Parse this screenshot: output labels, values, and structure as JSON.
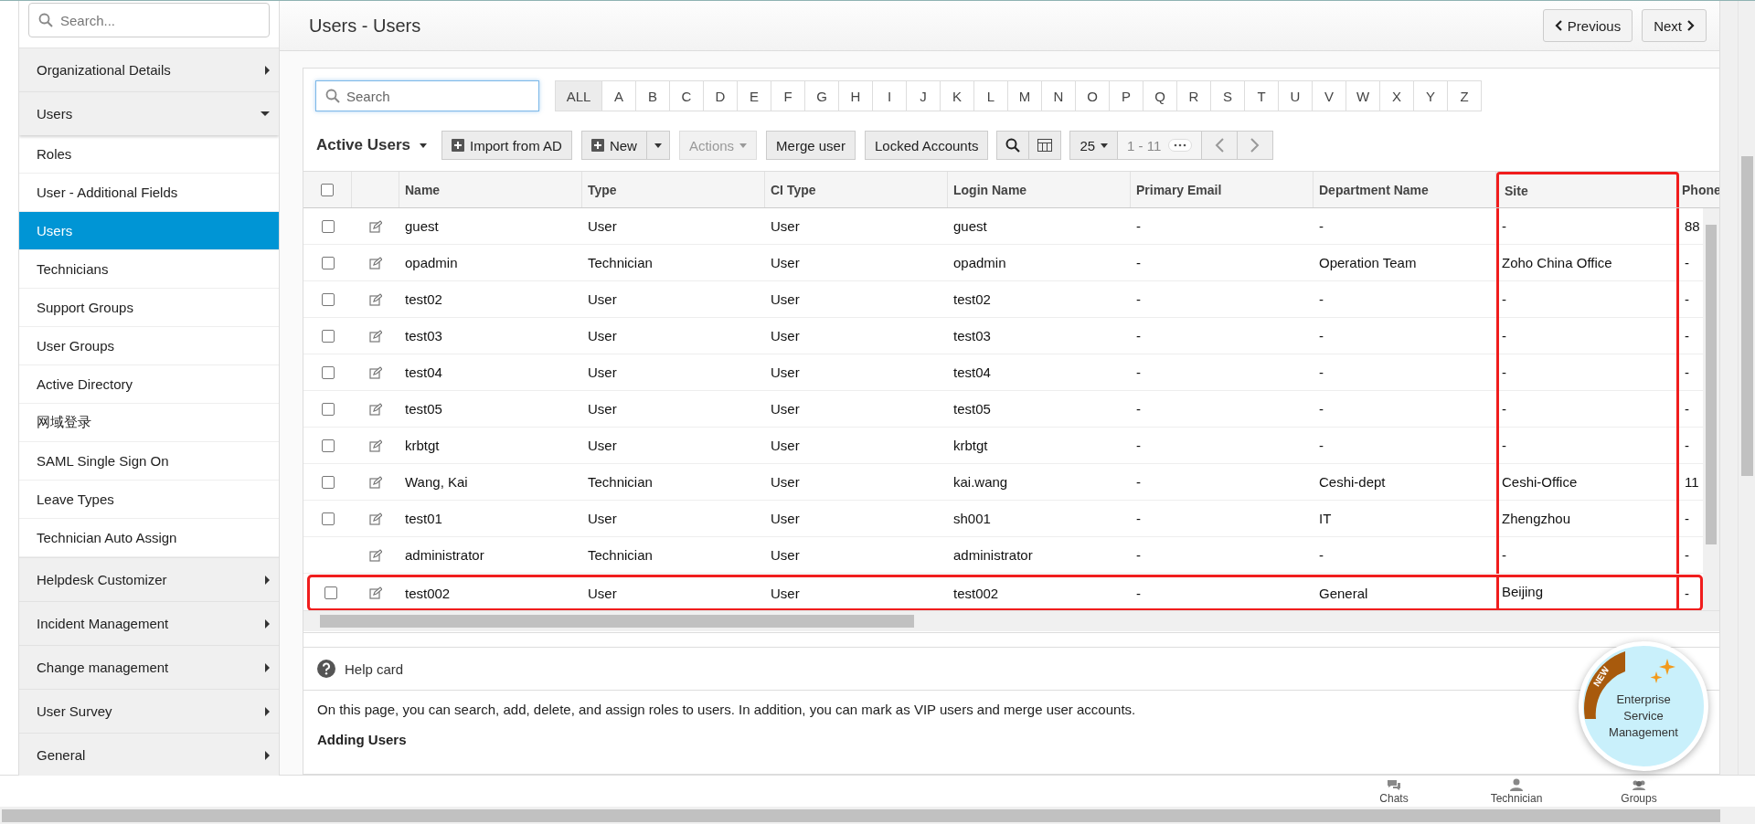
{
  "sidebar": {
    "search": {
      "placeholder": "Search..."
    },
    "sections": [
      {
        "label": "Organizational Details",
        "expanded": false
      },
      {
        "label": "Users",
        "expanded": true,
        "children": [
          {
            "label": "Roles",
            "selected": false
          },
          {
            "label": "User - Additional Fields",
            "selected": false
          },
          {
            "label": "Users",
            "selected": true
          },
          {
            "label": "Technicians",
            "selected": false
          },
          {
            "label": "Support Groups",
            "selected": false
          },
          {
            "label": "User Groups",
            "selected": false
          },
          {
            "label": "Active Directory",
            "selected": false
          },
          {
            "label": "网域登录",
            "selected": false
          },
          {
            "label": "SAML Single Sign On",
            "selected": false
          },
          {
            "label": "Leave Types",
            "selected": false
          },
          {
            "label": "Technician Auto Assign",
            "selected": false
          }
        ]
      },
      {
        "label": "Helpdesk Customizer",
        "expanded": false
      },
      {
        "label": "Incident Management",
        "expanded": false
      },
      {
        "label": "Change management",
        "expanded": false
      },
      {
        "label": "User Survey",
        "expanded": false
      },
      {
        "label": "General",
        "expanded": false
      }
    ]
  },
  "page": {
    "title": "Users - Users",
    "buttons": [
      {
        "label": "Previous",
        "kind": "prev"
      },
      {
        "label": "Next",
        "kind": "next"
      }
    ]
  },
  "filter": {
    "search": {
      "placeholder": "Search"
    },
    "letters": [
      {
        "label": "ALL",
        "selected": true
      },
      {
        "label": "A",
        "selected": false
      },
      {
        "label": "B",
        "selected": false
      },
      {
        "label": "C",
        "selected": false
      },
      {
        "label": "D",
        "selected": false
      },
      {
        "label": "E",
        "selected": false
      },
      {
        "label": "F",
        "selected": false
      },
      {
        "label": "G",
        "selected": false
      },
      {
        "label": "H",
        "selected": false
      },
      {
        "label": "I",
        "selected": false
      },
      {
        "label": "J",
        "selected": false
      },
      {
        "label": "K",
        "selected": false
      },
      {
        "label": "L",
        "selected": false
      },
      {
        "label": "M",
        "selected": false
      },
      {
        "label": "N",
        "selected": false
      },
      {
        "label": "O",
        "selected": false
      },
      {
        "label": "P",
        "selected": false
      },
      {
        "label": "Q",
        "selected": false
      },
      {
        "label": "R",
        "selected": false
      },
      {
        "label": "S",
        "selected": false
      },
      {
        "label": "T",
        "selected": false
      },
      {
        "label": "U",
        "selected": false
      },
      {
        "label": "V",
        "selected": false
      },
      {
        "label": "W",
        "selected": false
      },
      {
        "label": "X",
        "selected": false
      },
      {
        "label": "Y",
        "selected": false
      },
      {
        "label": "Z",
        "selected": false
      }
    ]
  },
  "toolbar": {
    "view": "Active Users",
    "buttons": [
      {
        "kind": "import",
        "label": "Import from AD",
        "disabled": false
      },
      {
        "kind": "split",
        "label": "New",
        "disabled": false
      },
      {
        "kind": "dropdown",
        "label": "Actions",
        "disabled": true
      },
      {
        "kind": "plain",
        "label": "Merge user",
        "disabled": false
      },
      {
        "kind": "plain",
        "label": "Locked Accounts",
        "disabled": false
      }
    ],
    "page_size": "25",
    "range": "1 - 11"
  },
  "table": {
    "select_all_checked": false,
    "columns": [
      {
        "label": "Name",
        "highlighted": false
      },
      {
        "label": "Type",
        "highlighted": false
      },
      {
        "label": "CI Type",
        "highlighted": false
      },
      {
        "label": "Login Name",
        "highlighted": false
      },
      {
        "label": "Primary Email",
        "highlighted": false
      },
      {
        "label": "Department Name",
        "highlighted": false
      },
      {
        "label": "Site",
        "highlighted": true
      },
      {
        "label": "Phone",
        "highlighted": false
      }
    ],
    "rows": [
      {
        "selectable": true,
        "checked": false,
        "highlighted": false,
        "cells": [
          "guest",
          "User",
          "User",
          "guest",
          "-",
          "-",
          "-",
          "88"
        ]
      },
      {
        "selectable": true,
        "checked": false,
        "highlighted": false,
        "cells": [
          "opadmin",
          "Technician",
          "User",
          "opadmin",
          "-",
          "Operation Team",
          "Zoho China Office",
          "-"
        ]
      },
      {
        "selectable": true,
        "checked": false,
        "highlighted": false,
        "cells": [
          "test02",
          "User",
          "User",
          "test02",
          "-",
          "-",
          "-",
          "-"
        ]
      },
      {
        "selectable": true,
        "checked": false,
        "highlighted": false,
        "cells": [
          "test03",
          "User",
          "User",
          "test03",
          "-",
          "-",
          "-",
          "-"
        ]
      },
      {
        "selectable": true,
        "checked": false,
        "highlighted": false,
        "cells": [
          "test04",
          "User",
          "User",
          "test04",
          "-",
          "-",
          "-",
          "-"
        ]
      },
      {
        "selectable": true,
        "checked": false,
        "highlighted": false,
        "cells": [
          "test05",
          "User",
          "User",
          "test05",
          "-",
          "-",
          "-",
          "-"
        ]
      },
      {
        "selectable": true,
        "checked": false,
        "highlighted": false,
        "cells": [
          "krbtgt",
          "User",
          "User",
          "krbtgt",
          "-",
          "-",
          "-",
          "-"
        ]
      },
      {
        "selectable": true,
        "checked": false,
        "highlighted": false,
        "cells": [
          "Wang, Kai",
          "Technician",
          "User",
          "kai.wang",
          "-",
          "Ceshi-dept",
          "Ceshi-Office",
          "11"
        ]
      },
      {
        "selectable": true,
        "checked": false,
        "highlighted": false,
        "cells": [
          "test01",
          "User",
          "User",
          "sh001",
          "-",
          "IT",
          "Zhengzhou",
          "-"
        ]
      },
      {
        "selectable": false,
        "highlighted": false,
        "cells": [
          "administrator",
          "Technician",
          "User",
          "administrator",
          "-",
          "-",
          "-",
          "-"
        ]
      },
      {
        "selectable": true,
        "checked": false,
        "highlighted": true,
        "cells": [
          "test002",
          "User",
          "User",
          "test002",
          "-",
          "General",
          "Beijing",
          "-"
        ]
      }
    ]
  },
  "help_card": {
    "title": "Help card",
    "text": "On this page, you can search, add, delete, and assign roles to users. In addition, you can mark as VIP users and merge user accounts.",
    "heading": "Adding Users"
  },
  "badge": {
    "ribbon": "NEW",
    "text": "Enterprise Service Management"
  },
  "bottom_bar": {
    "items": [
      {
        "label": "Chats",
        "kind": "chat"
      },
      {
        "label": "Technician",
        "kind": "person"
      },
      {
        "label": "Groups",
        "kind": "group"
      }
    ]
  }
}
